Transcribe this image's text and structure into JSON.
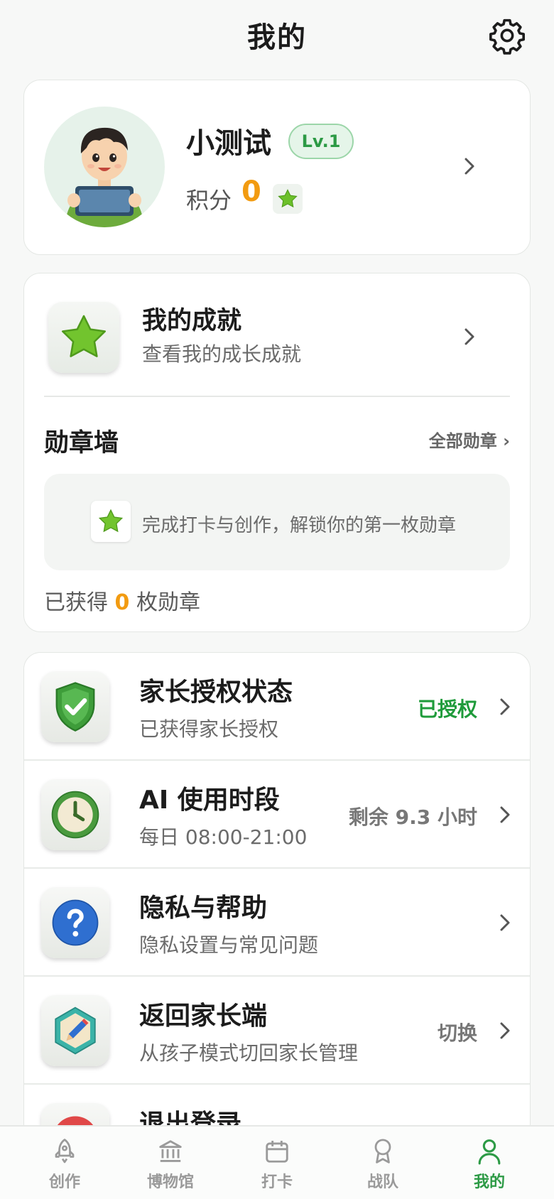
{
  "header": {
    "title": "我的",
    "settings_icon": "gear-icon"
  },
  "profile": {
    "username": "小测试",
    "level": "Lv.1",
    "points_label": "积分",
    "points_value": "0",
    "points_icon": "star-icon"
  },
  "achievements": {
    "title": "我的成就",
    "subtitle": "查看我的成长成就",
    "badge_wall_title": "勋章墙",
    "all_badges_link": "全部勋章 ›",
    "empty_text": "完成打卡与创作，解锁你的第一枚勋章",
    "earned_prefix": "已获得",
    "earned_count": "0",
    "earned_suffix": "枚勋章"
  },
  "settings_list": [
    {
      "title": "家长授权状态",
      "subtitle": "已获得家长授权",
      "status": "已授权",
      "icon": "shield-check-icon"
    },
    {
      "title": "AI 使用时段",
      "subtitle": "每日 08:00-21:00",
      "status": "剩余 9.3 小时",
      "icon": "clock-icon"
    },
    {
      "title": "隐私与帮助",
      "subtitle": "隐私设置与常见问题",
      "status": "",
      "icon": "question-icon"
    },
    {
      "title": "返回家长端",
      "subtitle": "从孩子模式切回家长管理",
      "status": "切换",
      "icon": "pencil-icon"
    },
    {
      "title": "退出登录",
      "subtitle": "",
      "status": "",
      "icon": "logout-icon"
    }
  ],
  "tabbar": {
    "tabs": [
      {
        "label": "创作",
        "icon": "rocket-icon"
      },
      {
        "label": "博物馆",
        "icon": "museum-icon"
      },
      {
        "label": "打卡",
        "icon": "calendar-icon"
      },
      {
        "label": "战队",
        "icon": "medal-icon"
      },
      {
        "label": "我的",
        "icon": "person-icon"
      }
    ],
    "active_index": 4
  },
  "colors": {
    "accent_green": "#2c9a45",
    "points_orange": "#f29b11"
  }
}
